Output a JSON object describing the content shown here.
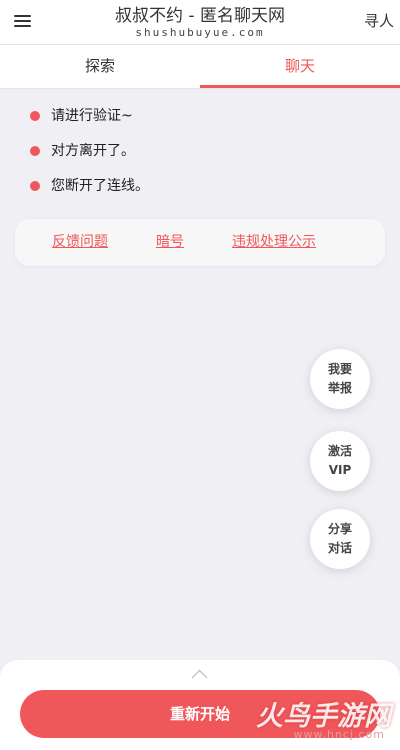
{
  "header": {
    "title": "叔叔不约 - 匿名聊天网",
    "subtitle": "shushubuyue.com",
    "find_label": "寻人"
  },
  "tabs": [
    {
      "label": "探索",
      "active": false
    },
    {
      "label": "聊天",
      "active": true
    }
  ],
  "messages": [
    "请进行验证~",
    "对方离开了。",
    "您断开了连线。"
  ],
  "links": {
    "feedback": "反馈问题",
    "code": "暗号",
    "violation": "违规处理公示"
  },
  "floating_buttons": {
    "report": [
      "我要",
      "举报"
    ],
    "vip": [
      "激活",
      "VIP"
    ],
    "share": [
      "分享",
      "对话"
    ]
  },
  "bottom": {
    "restart_label": "重新开始"
  },
  "watermark": {
    "main": "火鸟手游网",
    "url": "www.hncj.com"
  },
  "colors": {
    "accent": "#f0575b",
    "background": "#efeff4"
  }
}
